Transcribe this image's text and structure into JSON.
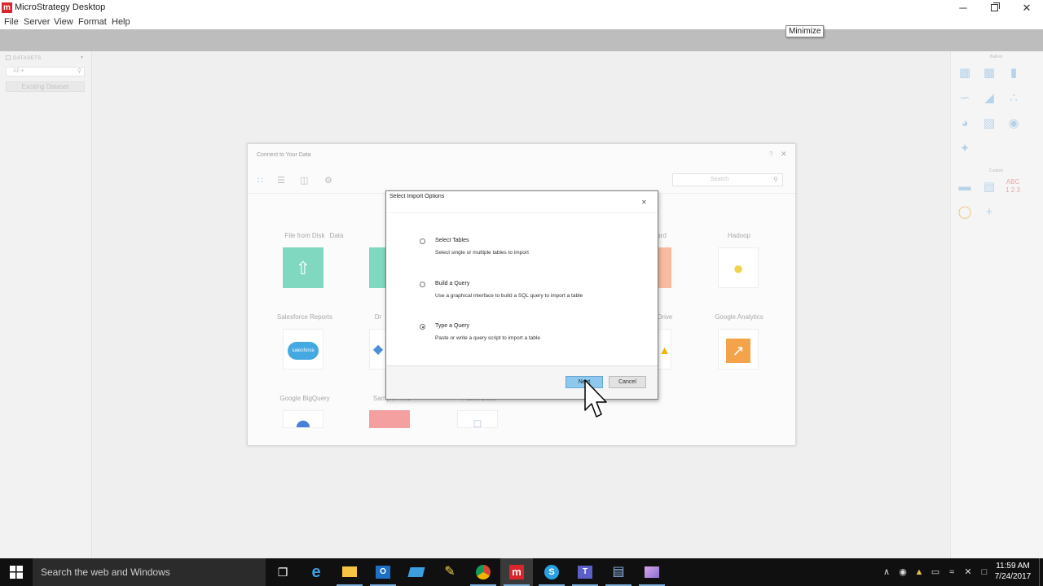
{
  "window": {
    "title": "MicroStrategy Desktop",
    "logo_text": "m",
    "tooltip": "Minimize",
    "controls": {
      "minimize": "─",
      "close": "✕"
    }
  },
  "menu": {
    "file": "File",
    "server": "Server",
    "view": "View",
    "format": "Format",
    "help": "Help"
  },
  "datasets_panel": {
    "header": "DATASETS",
    "collapse": "▾",
    "filter_value": "All",
    "filter_arrow": "▾",
    "existing_dataset": "Existing Dataset"
  },
  "gallery": {
    "builtin_label": "Built-in",
    "custom_label": "Custom",
    "abc_label": "ABC",
    "num_label": "1 2 3",
    "icon_color": "#b7d3ea"
  },
  "connect_dialog": {
    "title": "Connect to Your Data",
    "help": "?",
    "close": "✕",
    "search_placeholder": "Search",
    "sources": {
      "file_from_disk": "File from Disk",
      "data_from_url": "Data",
      "clipboard": "ard",
      "hadoop": "Hadoop",
      "salesforce": "Salesforce Reports",
      "dropbox": "Dr",
      "google_drive": "Drive",
      "google_analytics": "Google Analytics",
      "google_bigquery": "Google BigQuery",
      "sample_files": "Sample Files",
      "public_data": "Public Data",
      "salesforce_logo": "salesforce"
    },
    "accent_color": "#7fd8bf"
  },
  "modal": {
    "title": "Select Import Options",
    "close": "✕",
    "options": [
      {
        "title": "Select Tables",
        "desc": "Select single or multiple tables to import",
        "checked": false
      },
      {
        "title": "Build a Query",
        "desc": "Use a graphical interface to build a SQL query to import a table",
        "checked": false
      },
      {
        "title": "Type a Query",
        "desc": "Paste or write a query script to import a table",
        "checked": true
      }
    ],
    "next_label": "Next",
    "cancel_label": "Cancel"
  },
  "taskbar": {
    "search_placeholder": "Search the web and Windows",
    "time": "11:59 AM",
    "date": "7/24/2017"
  }
}
